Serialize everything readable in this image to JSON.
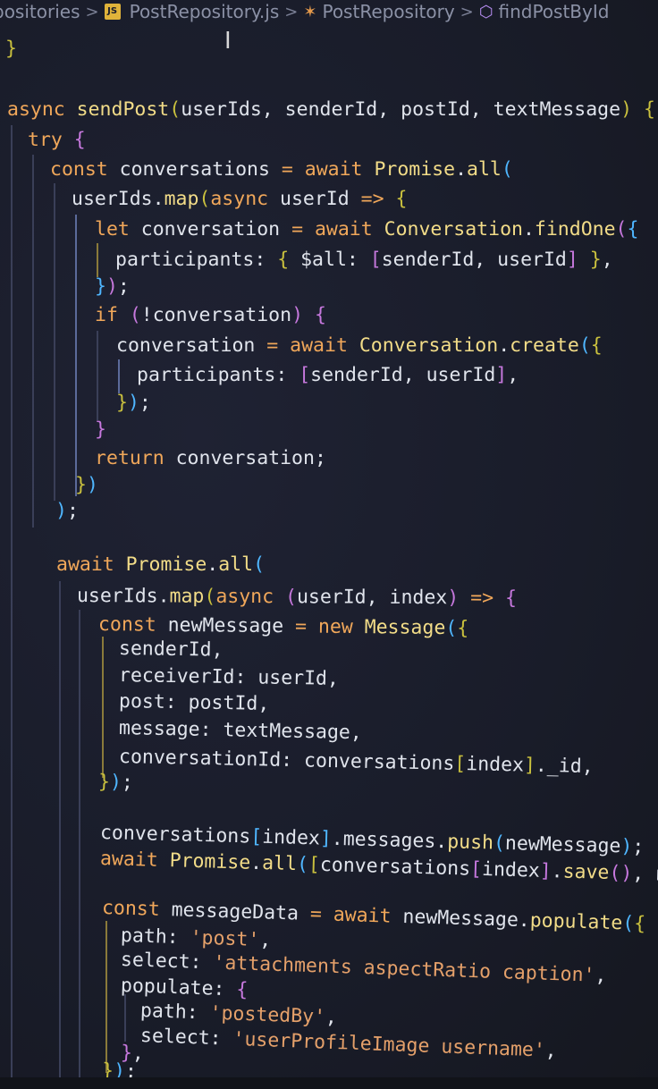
{
  "breadcrumb": {
    "items": [
      {
        "label": "positories"
      },
      {
        "label": "PostRepository.js",
        "icon": "js-file-icon",
        "icon_text": "JS"
      },
      {
        "label": "PostRepository",
        "icon": "class-icon"
      },
      {
        "label": "findPostById",
        "icon": "method-icon"
      }
    ],
    "separator": ">"
  },
  "cursor": {
    "icon": "text-cursor-icon",
    "glyph": "I"
  },
  "colors": {
    "background": "#1a1d2b",
    "keyword": "#f0a75a",
    "function": "#f2dc88",
    "bracket_yellow": "#c9c03e",
    "bracket_purple": "#c678dd",
    "bracket_blue": "#4fb6ff",
    "string": "#e4a06a",
    "plain": "#dfe3ea"
  },
  "code": {
    "lines": [
      [
        [
          "br",
          "}"
        ]
      ],
      [],
      [
        [
          "kw",
          "async "
        ],
        [
          "fn",
          "sendPost"
        ],
        [
          "br",
          "("
        ],
        [
          "pl",
          "userIds, senderId, postId, textMessage"
        ],
        [
          "br",
          ")"
        ],
        [
          "pl",
          " "
        ],
        [
          "br",
          "{"
        ]
      ],
      [
        [
          "kw",
          "try "
        ],
        [
          "br2",
          "{"
        ]
      ],
      [
        [
          "kw",
          "const "
        ],
        [
          "pl",
          "conversations "
        ],
        [
          "op",
          "= "
        ],
        [
          "kw",
          "await "
        ],
        [
          "fn",
          "Promise"
        ],
        [
          "pl",
          "."
        ],
        [
          "fn",
          "all"
        ],
        [
          "br3",
          "("
        ]
      ],
      [
        [
          "pl",
          "userIds."
        ],
        [
          "fn",
          "map"
        ],
        [
          "br",
          "("
        ],
        [
          "kw",
          "async "
        ],
        [
          "pl",
          "userId "
        ],
        [
          "op",
          "=> "
        ],
        [
          "br",
          "{"
        ]
      ],
      [
        [
          "kw",
          "let "
        ],
        [
          "pl",
          "conversation "
        ],
        [
          "op",
          "= "
        ],
        [
          "kw",
          "await "
        ],
        [
          "fn",
          "Conversation"
        ],
        [
          "pl",
          "."
        ],
        [
          "fn",
          "findOne"
        ],
        [
          "br2",
          "("
        ],
        [
          "br3",
          "{"
        ]
      ],
      [
        [
          "pl",
          "participants: "
        ],
        [
          "br",
          "{ "
        ],
        [
          "pl",
          "$all: "
        ],
        [
          "br2",
          "["
        ],
        [
          "pl",
          "senderId, userId"
        ],
        [
          "br2",
          "]"
        ],
        [
          "br",
          " }"
        ],
        [
          "pl",
          ","
        ]
      ],
      [
        [
          "br3",
          "}"
        ],
        [
          "br2",
          ")"
        ],
        [
          "pl",
          ";"
        ]
      ],
      [
        [
          "kw",
          "if "
        ],
        [
          "br2",
          "("
        ],
        [
          "pl",
          "!conversation"
        ],
        [
          "br2",
          ")"
        ],
        [
          "pl",
          " "
        ],
        [
          "br2",
          "{"
        ]
      ],
      [
        [
          "pl",
          "conversation "
        ],
        [
          "op",
          "= "
        ],
        [
          "kw",
          "await "
        ],
        [
          "fn",
          "Conversation"
        ],
        [
          "pl",
          "."
        ],
        [
          "fn",
          "create"
        ],
        [
          "br3",
          "("
        ],
        [
          "br",
          "{"
        ]
      ],
      [
        [
          "pl",
          "participants: "
        ],
        [
          "br2",
          "["
        ],
        [
          "pl",
          "senderId, userId"
        ],
        [
          "br2",
          "]"
        ],
        [
          "pl",
          ","
        ]
      ],
      [
        [
          "br",
          "}"
        ],
        [
          "br3",
          ")"
        ],
        [
          "pl",
          ";"
        ]
      ],
      [
        [
          "br2",
          "}"
        ]
      ],
      [
        [
          "kw",
          "return "
        ],
        [
          "pl",
          "conversation;"
        ]
      ],
      [
        [
          "br",
          "}"
        ],
        [
          "br3",
          ")"
        ]
      ],
      [
        [
          "br3",
          ")"
        ],
        [
          "pl",
          ";"
        ]
      ],
      [],
      [
        [
          "kw",
          "await "
        ],
        [
          "fn",
          "Promise"
        ],
        [
          "pl",
          "."
        ],
        [
          "fn",
          "all"
        ],
        [
          "br3",
          "("
        ]
      ],
      [
        [
          "pl",
          "userIds."
        ],
        [
          "fn",
          "map"
        ],
        [
          "br",
          "("
        ],
        [
          "kw",
          "async "
        ],
        [
          "br2",
          "("
        ],
        [
          "pl",
          "userId, index"
        ],
        [
          "br2",
          ")"
        ],
        [
          "pl",
          " "
        ],
        [
          "op",
          "=> "
        ],
        [
          "br2",
          "{"
        ]
      ],
      [
        [
          "kw",
          "const "
        ],
        [
          "pl",
          "newMessage "
        ],
        [
          "op",
          "= "
        ],
        [
          "kw",
          "new "
        ],
        [
          "fn",
          "Message"
        ],
        [
          "br3",
          "("
        ],
        [
          "br",
          "{"
        ]
      ],
      [
        [
          "pl",
          "senderId,"
        ]
      ],
      [
        [
          "pl",
          "receiverId: userId,"
        ]
      ],
      [
        [
          "pl",
          "post: postId,"
        ]
      ],
      [
        [
          "pl",
          "message: textMessage,"
        ]
      ],
      [
        [
          "pl",
          "conversationId: conversations"
        ],
        [
          "br",
          "["
        ],
        [
          "pl",
          "index"
        ],
        [
          "br",
          "]"
        ],
        [
          "pl",
          "._id,"
        ]
      ],
      [
        [
          "br",
          "}"
        ],
        [
          "br3",
          ")"
        ],
        [
          "pl",
          ";"
        ]
      ],
      [],
      [
        [
          "pl",
          "conversations"
        ],
        [
          "br3",
          "["
        ],
        [
          "pl",
          "index"
        ],
        [
          "br3",
          "]"
        ],
        [
          "pl",
          ".messages."
        ],
        [
          "fn",
          "push"
        ],
        [
          "br3",
          "("
        ],
        [
          "pl",
          "newMessage"
        ],
        [
          "br3",
          ")"
        ],
        [
          "pl",
          ";"
        ]
      ],
      [
        [
          "kw",
          "await "
        ],
        [
          "fn",
          "Promise"
        ],
        [
          "pl",
          "."
        ],
        [
          "fn",
          "all"
        ],
        [
          "br3",
          "("
        ],
        [
          "br",
          "["
        ],
        [
          "pl",
          "conversations"
        ],
        [
          "br2",
          "["
        ],
        [
          "pl",
          "index"
        ],
        [
          "br2",
          "]"
        ],
        [
          "pl",
          "."
        ],
        [
          "fn",
          "save"
        ],
        [
          "br2",
          "()"
        ],
        [
          "pl",
          ", newMess"
        ]
      ],
      [],
      [
        [
          "kw",
          "const "
        ],
        [
          "pl",
          "messageData "
        ],
        [
          "op",
          "= "
        ],
        [
          "kw",
          "await "
        ],
        [
          "pl",
          "newMessage."
        ],
        [
          "fn",
          "populate"
        ],
        [
          "br3",
          "("
        ],
        [
          "br",
          "{"
        ]
      ],
      [
        [
          "pl",
          "path: "
        ],
        [
          "str",
          "'post'"
        ],
        [
          "pl",
          ","
        ]
      ],
      [
        [
          "pl",
          "select: "
        ],
        [
          "str",
          "'attachments aspectRatio caption'"
        ],
        [
          "pl",
          ","
        ]
      ],
      [
        [
          "pl",
          "populate: "
        ],
        [
          "br2",
          "{"
        ]
      ],
      [
        [
          "pl",
          "path: "
        ],
        [
          "str",
          "'postedBy'"
        ],
        [
          "pl",
          ","
        ]
      ],
      [
        [
          "pl",
          "select: "
        ],
        [
          "str",
          "'userProfileImage username'"
        ],
        [
          "pl",
          ","
        ]
      ],
      [
        [
          "br2",
          "}"
        ],
        [
          "pl",
          ","
        ]
      ],
      [
        [
          "br",
          "}"
        ],
        [
          "br3",
          ")"
        ],
        [
          "pl",
          ";"
        ]
      ]
    ]
  }
}
